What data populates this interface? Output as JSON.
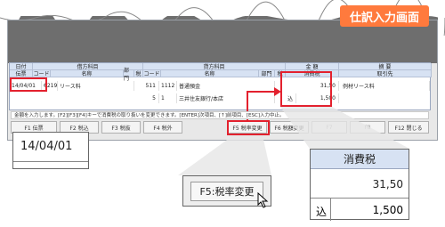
{
  "title_tag": "仕訳入力画面",
  "table": {
    "headers": {
      "date": "日付",
      "slip": "伝票",
      "debit_group": "借方科目",
      "credit_group": "貸方科目",
      "amount": "金 額",
      "summary": "摘 要",
      "debit_code": "コード",
      "debit_name": "名称",
      "debit_dept": "部門",
      "debit_tax": "税",
      "credit_code": "コード",
      "credit_name": "名称",
      "credit_dept": "部門",
      "credit_tax": "税",
      "consumption_tax": "消費税",
      "partner": "取引先"
    },
    "rows": [
      {
        "date": "14/04/01",
        "debit_code": "6219",
        "debit_name": "リース料",
        "debit_tax": "511",
        "credit_code": "1112",
        "credit_name": "普通預金",
        "amount": "31,50",
        "summary": "例材リース料"
      },
      {
        "debit_tax": "5",
        "credit_code": "1",
        "credit_name": "三井住友銀行/本店",
        "in_label": "込",
        "amount": "1,500"
      }
    ]
  },
  "status_text": "金額を入力します。[F2][F3][F4]キーで消費税の取り扱いを変更できます。[ENTER]次項目、[↑]前項目、[ESC]入力中止。",
  "fkeys": [
    "F1 伝票",
    "F2 税込",
    "F3 税抜",
    "F4 税外",
    "F5 税率変更",
    "F6 税額変更",
    "F7",
    "F8",
    "F12 閉じる"
  ],
  "zoom": {
    "date": "14/04/01",
    "key_label": "F5:税率変更",
    "tax_header": "消費税",
    "tax_amount": "31,50",
    "in_label": "込",
    "in_value": "1,500"
  },
  "colors": {
    "accent": "#ff7a3d",
    "highlight": "#e3212e",
    "header_bg": "#d7e2f3"
  }
}
